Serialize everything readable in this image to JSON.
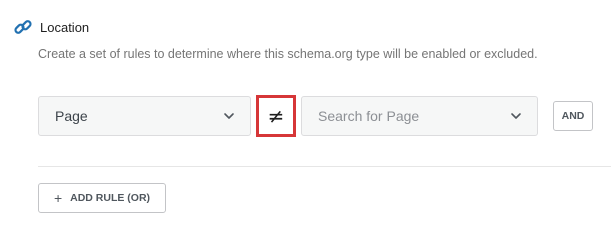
{
  "section": {
    "title": "Location",
    "icon": "link-icon",
    "description": "Create a set of rules to determine where this schema.org type will be enabled or excluded."
  },
  "rule": {
    "type_value": "Page",
    "operator": "≠",
    "value_placeholder": "Search for Page",
    "and_label": "AND"
  },
  "add_rule": {
    "label": "ADD RULE (OR)",
    "icon": "plus-icon"
  },
  "colors": {
    "link_icon": "#2271b1",
    "highlight_border": "#d63638",
    "select_background": "#f6f7f7"
  }
}
